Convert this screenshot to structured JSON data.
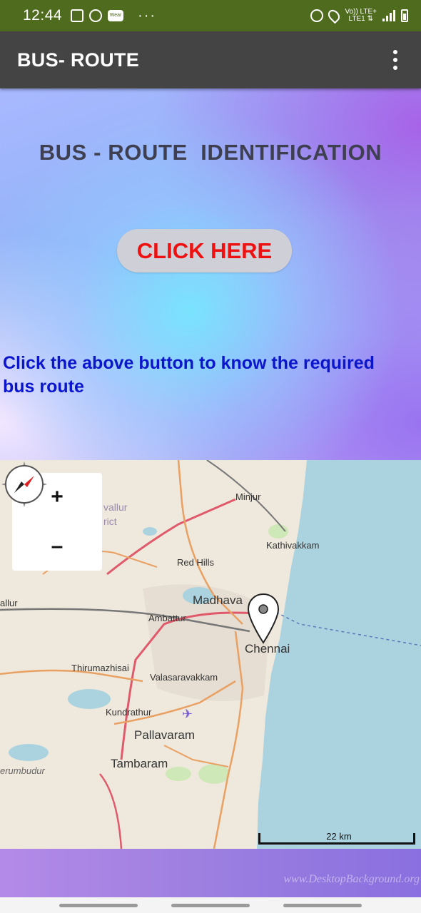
{
  "status_bar": {
    "time": "12:44",
    "network_label": "Vo)) LTE+",
    "network_label_2": "LTE1 ⇅",
    "left_icons": [
      "gallery-icon",
      "whatsapp-icon",
      "wear-icon",
      "more-dots-icon"
    ],
    "right_icons": [
      "alarm-icon",
      "location-icon",
      "signal-icon",
      "battery-icon"
    ],
    "wear_label": "Wear"
  },
  "app_bar": {
    "title": "BUS- ROUTE",
    "menu_icon": "overflow-menu-icon"
  },
  "main": {
    "heading": "BUS - ROUTE  IDENTIFICATION",
    "button_label": "CLICK HERE",
    "hint": "Click the above button to know the required bus route"
  },
  "map": {
    "zoom_in_label": "+",
    "zoom_out_label": "–",
    "scale_label": "22 km",
    "places": [
      "Minjur",
      "Kathivakkam",
      "Red Hills",
      "Madhavaram",
      "Ambattur",
      "Chennai",
      "Thirumazhisai",
      "Valasaravakkam",
      "Kundrathur",
      "Pallavaram",
      "Tambaram",
      "Tiruvallur District",
      "Tiruvallur",
      "Sriperumbudur"
    ],
    "visible_labels": {
      "minjur": "Minjur",
      "kathivakkam": "Kathivakkam",
      "red_hills": "Red Hills",
      "madhavaram": "Madhava",
      "ambattur": "Ambattur",
      "chennai": "Chennai",
      "thirumazhisai": "Thirumazhisai",
      "valasaravakkam": "Valasaravakkam",
      "kundrathur": "Kundrathur",
      "pallavaram": "Pallavaram",
      "tambaram": "Tambaram",
      "district_1": "vallur",
      "district_2": "rict",
      "tiruvallur": "allur",
      "sriperumbudur": "erumbudur"
    }
  },
  "footer": {
    "watermark": "www.DesktopBackground.org"
  },
  "colors": {
    "status_bar": "#4f6b1e",
    "app_bar": "#444444",
    "heading": "#3f3f52",
    "button_text": "#ee1111",
    "button_bg": "#cfcfd8",
    "hint": "#0b16cc",
    "sea": "#aad3df"
  }
}
